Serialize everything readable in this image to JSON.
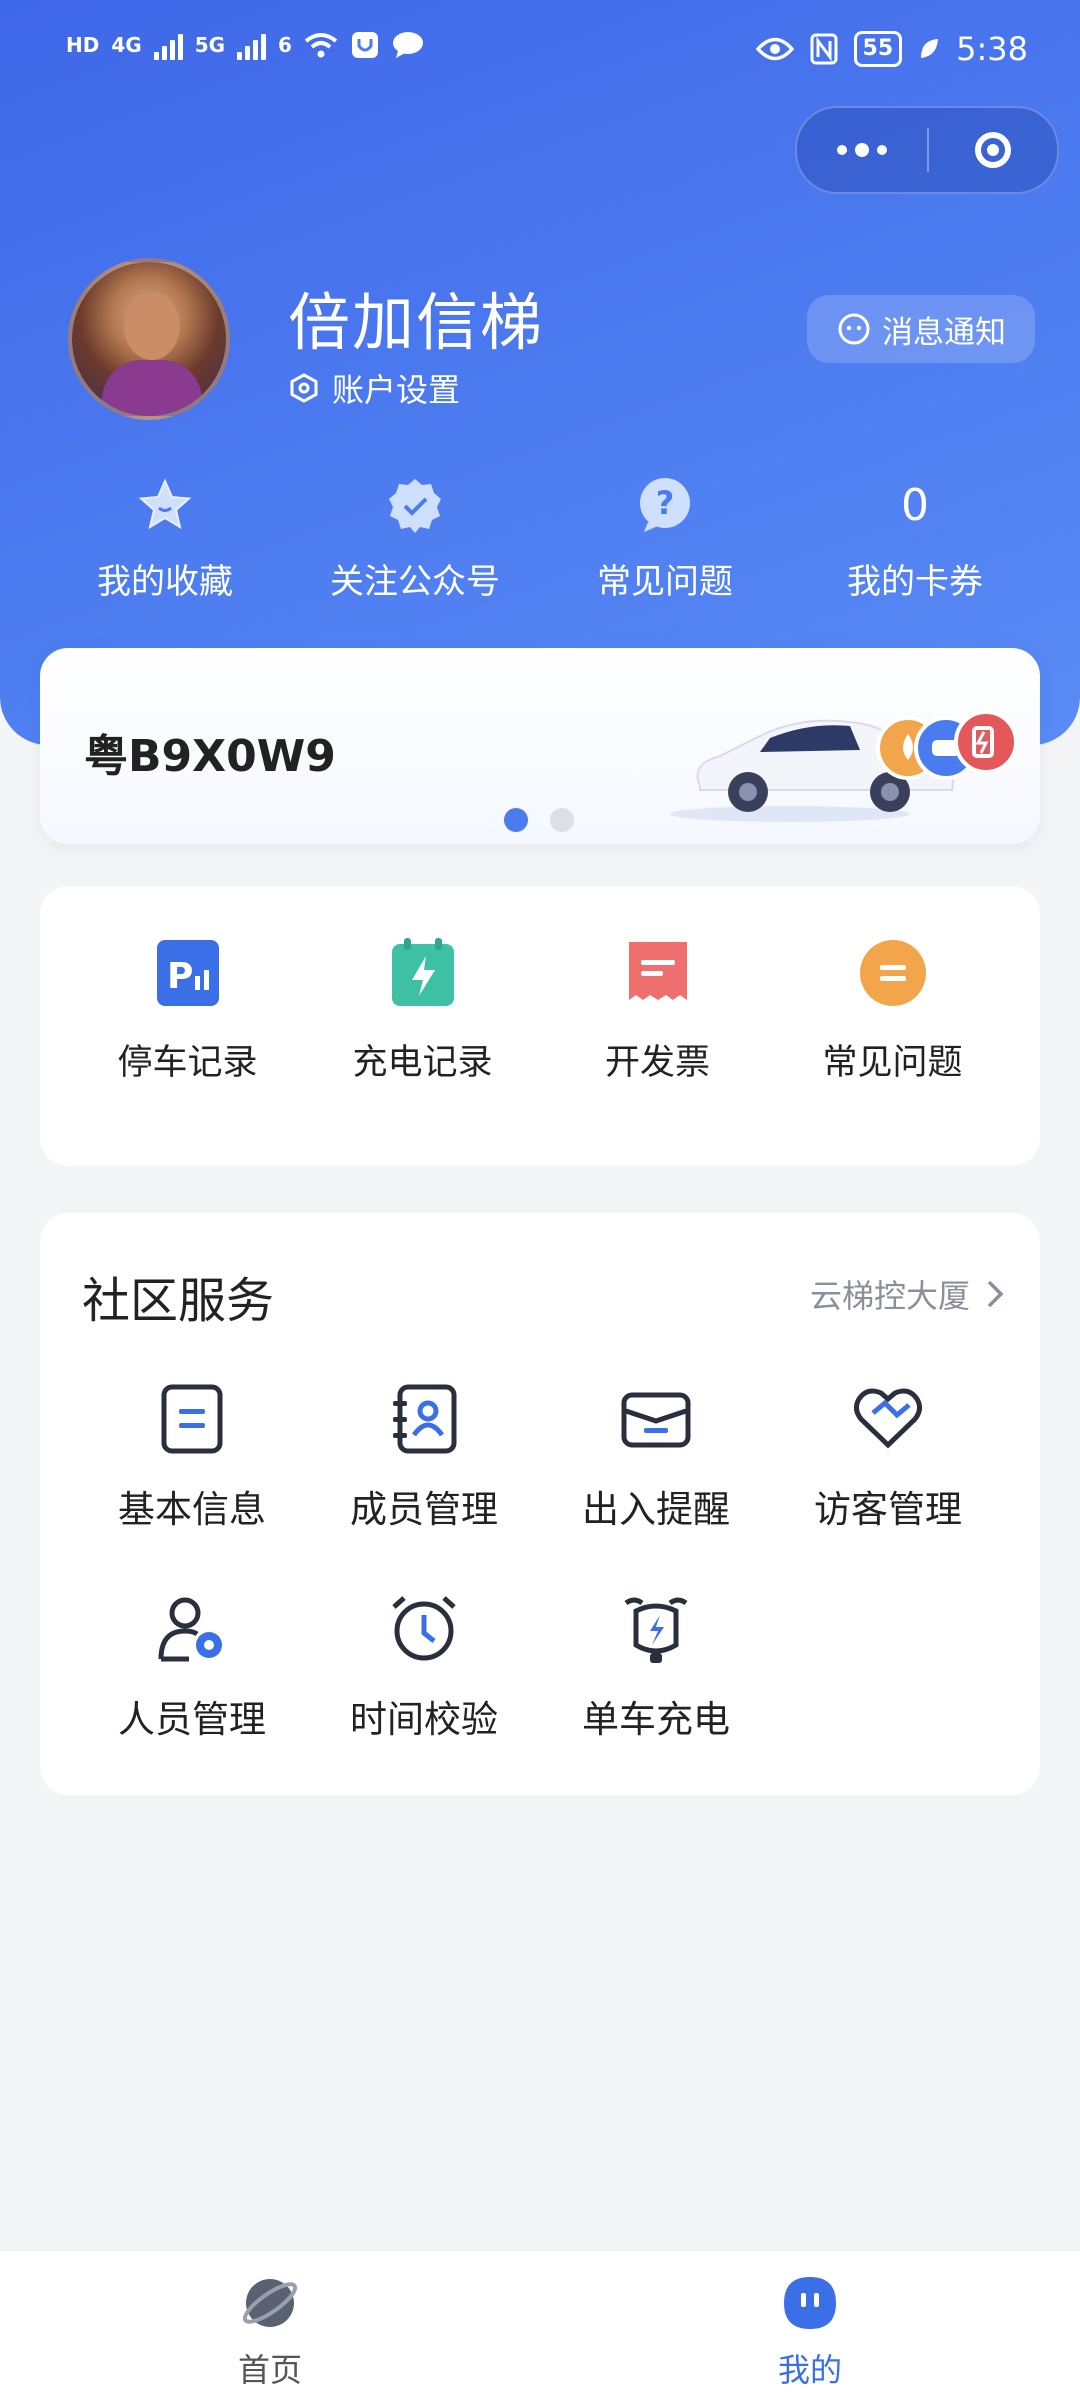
{
  "status_bar": {
    "network_labels": [
      "HD",
      "4G",
      "5G",
      "6"
    ],
    "battery": "55",
    "time": "5:38"
  },
  "profile": {
    "name": "倍加信梯",
    "account_settings": "账户设置",
    "message_button": "消息通知"
  },
  "quick_links": [
    {
      "label": "我的收藏",
      "icon": "star-icon"
    },
    {
      "label": "关注公众号",
      "icon": "verified-badge-icon"
    },
    {
      "label": "常见问题",
      "icon": "question-icon"
    },
    {
      "label": "我的卡券",
      "value": "0"
    }
  ],
  "plate_card": {
    "plate": "粤B9X0W9",
    "carousel_pages": 2,
    "active_page": 1
  },
  "services_row": [
    {
      "label": "停车记录",
      "icon": "parking-icon",
      "color": "#3b6fe8"
    },
    {
      "label": "充电记录",
      "icon": "charging-icon",
      "color": "#3ec0a4"
    },
    {
      "label": "开发票",
      "icon": "receipt-icon",
      "color": "#ef6e6e"
    },
    {
      "label": "常见问题",
      "icon": "faq-icon",
      "color": "#f2a54a"
    }
  ],
  "community": {
    "title": "社区服务",
    "location": "云梯控大厦",
    "items": [
      {
        "label": "基本信息",
        "icon": "document-icon"
      },
      {
        "label": "成员管理",
        "icon": "contacts-icon"
      },
      {
        "label": "出入提醒",
        "icon": "mail-icon"
      },
      {
        "label": "访客管理",
        "icon": "heart-handshake-icon"
      },
      {
        "label": "人员管理",
        "icon": "user-settings-icon"
      },
      {
        "label": "时间校验",
        "icon": "alarm-clock-icon"
      },
      {
        "label": "单车充电",
        "icon": "scooter-charge-icon"
      }
    ]
  },
  "tab_bar": {
    "tabs": [
      {
        "label": "首页",
        "icon": "planet-icon",
        "active": false
      },
      {
        "label": "我的",
        "icon": "profile-face-icon",
        "active": true
      }
    ]
  },
  "colors": {
    "brand": "#4a7cf0",
    "accent_blue": "#3b6fe8",
    "background": "#f4f5f7"
  }
}
